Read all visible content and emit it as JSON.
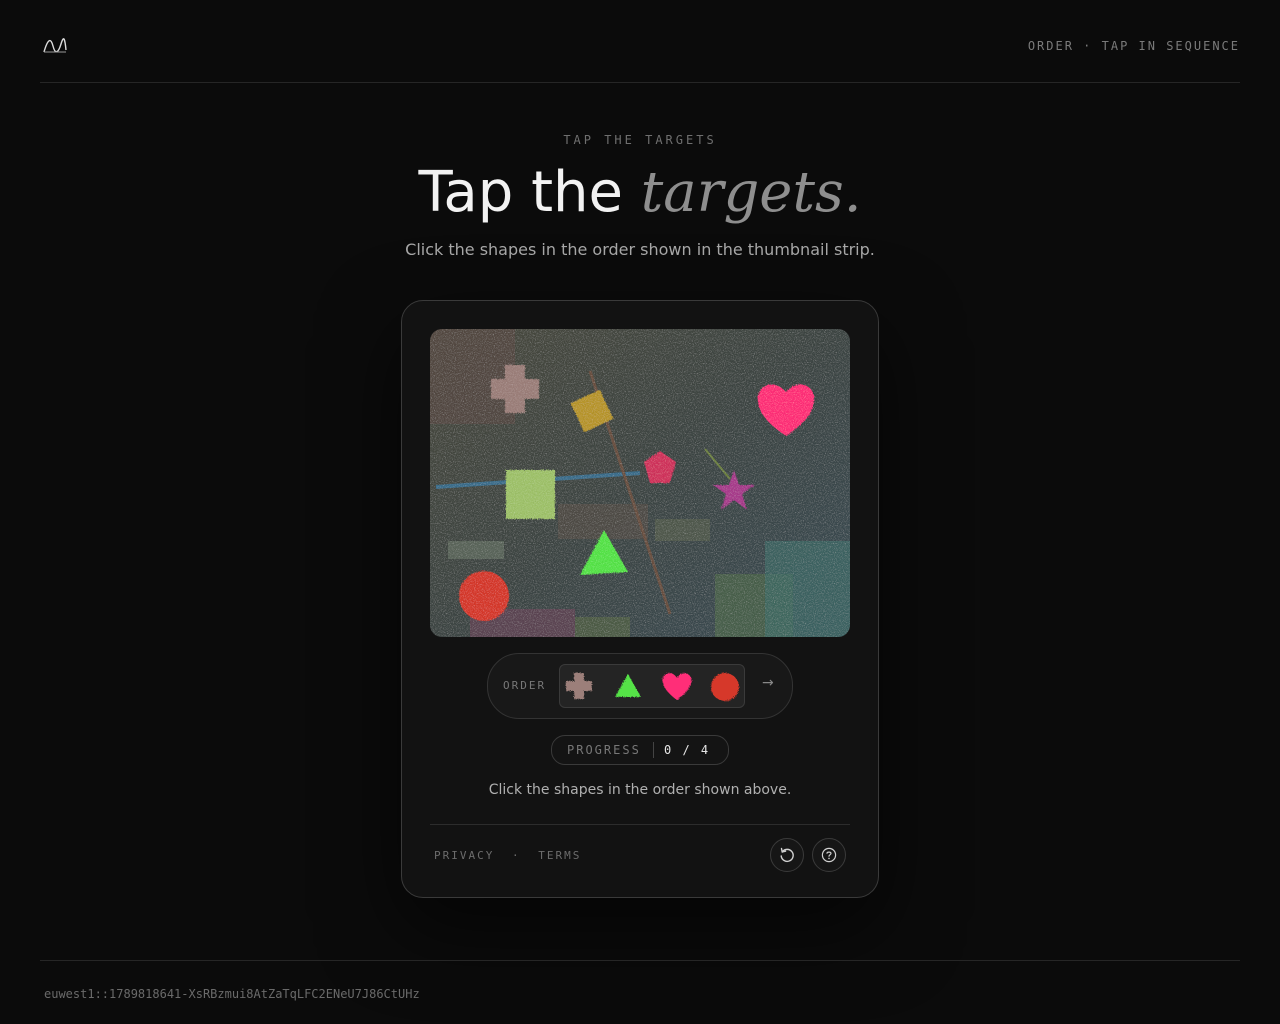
{
  "header": {
    "logo_icon": "wave-logo-icon",
    "nav_label": "ORDER · TAP IN SEQUENCE"
  },
  "hero": {
    "eyebrow": "TAP THE TARGETS",
    "title_plain": "Tap the ",
    "title_emphasis": "targets.",
    "subtitle": "Click the shapes in the order shown in the thumbnail strip."
  },
  "card": {
    "canvas": {
      "background": "#3f4a44",
      "shapes": [
        "cross",
        "diamond",
        "heart",
        "pentagon",
        "square",
        "star",
        "triangle",
        "circle"
      ],
      "shape_colors": {
        "cross": "#9c7f7a",
        "diamond": "#b8962c",
        "heart": "#ff2f78",
        "pentagon": "#d0305c",
        "square": "#9fc26a",
        "star": "#a83a8c",
        "triangle": "#55e347",
        "circle": "#d6392c"
      }
    },
    "order": {
      "label": "ORDER",
      "sequence": [
        "cross",
        "triangle",
        "heart",
        "circle"
      ],
      "next_icon": "arrow-right-icon",
      "next_glyph": "→"
    },
    "progress": {
      "label": "PROGRESS",
      "value": "0 / 4",
      "completed": 0,
      "total": 4
    },
    "instruction": "Click the shapes in the order shown above.",
    "footer": {
      "privacy": "PRIVACY",
      "separator": "·",
      "terms": "TERMS",
      "refresh_icon": "refresh-icon",
      "help_icon": "help-icon"
    }
  },
  "session_id": "euwest1::1789818641-XsRBzmui8AtZaTqLFC2ENeU7J86CtUHz"
}
